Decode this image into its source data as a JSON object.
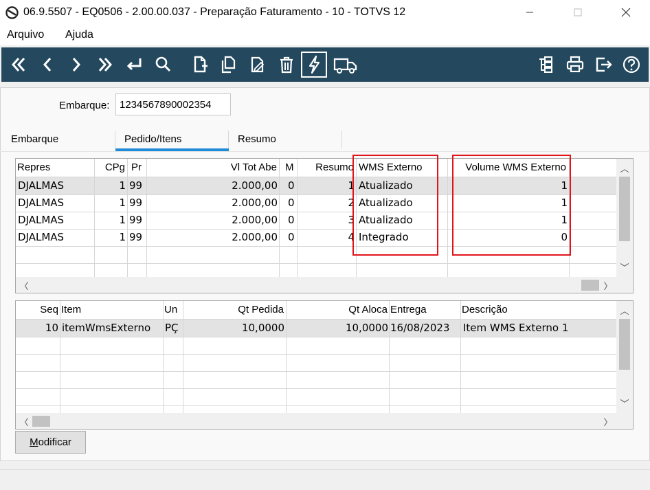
{
  "window": {
    "title": "06.9.5507 - EQ0506 - 2.00.00.037 - Preparação Faturamento - 10 - TOTVS 12"
  },
  "menu": {
    "arquivo": "Arquivo",
    "ajuda": "Ajuda"
  },
  "toolbar": {
    "background": "#24495f",
    "left_icons": [
      "first-icon",
      "previous-icon",
      "next-icon",
      "last-icon",
      "return-icon",
      "search-icon",
      "new-document-icon",
      "copy-icon",
      "edit-icon",
      "delete-icon",
      "lightning-icon",
      "truck-icon"
    ],
    "right_icons": [
      "network-icon",
      "print-icon",
      "exit-icon",
      "help-icon"
    ]
  },
  "form": {
    "embarque_label": "Embarque:",
    "embarque_value": "1234567890002354"
  },
  "tabs": [
    {
      "label": "Embarque"
    },
    {
      "label": "Pedido/Itens",
      "active": true
    },
    {
      "label": "Resumo"
    }
  ],
  "grid_top": {
    "headers": [
      "Repres",
      "CPg",
      "Pr",
      "Vl Tot Abe",
      "M",
      "Resumo",
      "WMS Externo",
      "Volume WMS Externo"
    ],
    "rows": [
      {
        "repres": "DJALMAS",
        "cpg": "1",
        "pr": "99",
        "vl_tot_abe": "2.000,00",
        "m": "0",
        "resumo": "1",
        "wms_externo": "Atualizado",
        "volume_wms": "1"
      },
      {
        "repres": "DJALMAS",
        "cpg": "1",
        "pr": "99",
        "vl_tot_abe": "2.000,00",
        "m": "0",
        "resumo": "2",
        "wms_externo": "Atualizado",
        "volume_wms": "1"
      },
      {
        "repres": "DJALMAS",
        "cpg": "1",
        "pr": "99",
        "vl_tot_abe": "2.000,00",
        "m": "0",
        "resumo": "3",
        "wms_externo": "Atualizado",
        "volume_wms": "1"
      },
      {
        "repres": "DJALMAS",
        "cpg": "1",
        "pr": "99",
        "vl_tot_abe": "2.000,00",
        "m": "0",
        "resumo": "4",
        "wms_externo": "Integrado",
        "volume_wms": "0"
      }
    ]
  },
  "grid_bottom": {
    "headers": [
      "Seq",
      "Item",
      "Un",
      "Qt Pedida",
      "Qt Aloca",
      "Entrega",
      "Descrição"
    ],
    "rows": [
      {
        "seq": "10",
        "item": "itemWmsExterno",
        "un": "PÇ",
        "qt_pedida": "10,0000",
        "qt_aloca": "10,0000",
        "entrega": "16/08/2023",
        "descricao": "Item WMS Externo 1"
      }
    ]
  },
  "buttons": {
    "modificar_first": "M",
    "modificar_rest": "odificar"
  },
  "colors": {
    "highlight_box": "#e0141a",
    "tab_underline": "#1f8ad6",
    "selected_row": "#e3e3e3"
  }
}
